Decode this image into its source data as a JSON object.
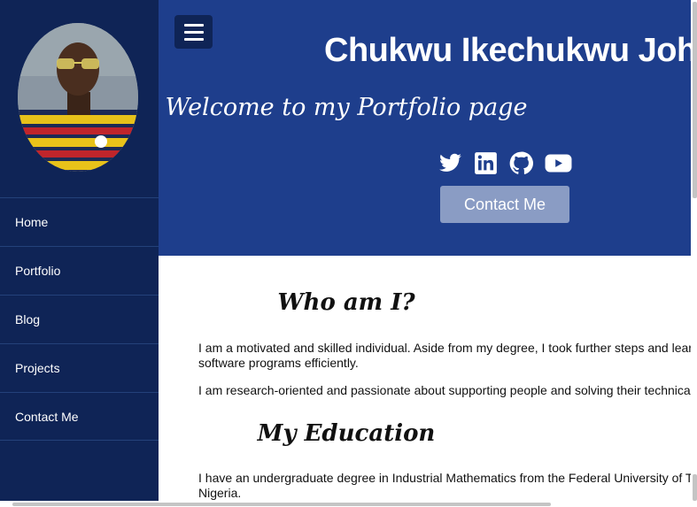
{
  "sidebar": {
    "avatar_alt": "",
    "nav": [
      "Home",
      "Portfolio",
      "Blog",
      "Projects",
      "Contact Me"
    ]
  },
  "header": {
    "name": "Chukwu Ikechukwu John",
    "welcome": "Welcome to my Portfolio page",
    "social_icons": [
      "twitter-icon",
      "linkedin-icon",
      "github-icon",
      "youtube-icon"
    ],
    "contact_button": "Contact Me"
  },
  "main": {
    "who_title": "Who am I?",
    "who_p1": "I am a motivated and skilled individual. Aside from my degree, I took further steps and lear",
    "who_p1b": "software programs efficiently.",
    "who_p2": "I am research-oriented and passionate about supporting people and solving their technica",
    "edu_title": "My Education",
    "edu_p1": "I have an undergraduate degree in Industrial Mathematics from the Federal University of T",
    "edu_p1b": "Nigeria."
  },
  "colors": {
    "sidebar": "#0f2456",
    "header": "#1e3e8c",
    "contact_button": "#8a9cc4"
  }
}
